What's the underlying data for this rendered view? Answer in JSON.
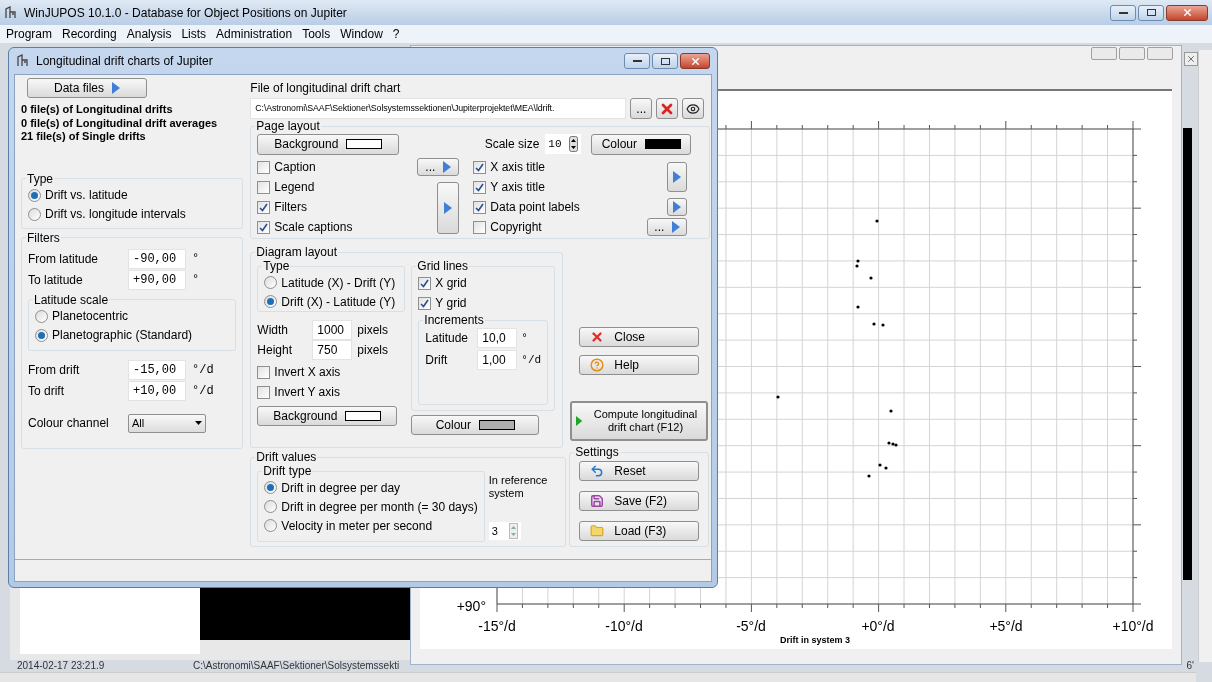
{
  "app_window": {
    "title": "WinJUPOS 10.1.0 - Database for Object Positions on Jupiter"
  },
  "menu": [
    "Program",
    "Recording",
    "Analysis",
    "Lists",
    "Administration",
    "Tools",
    "Window",
    "?"
  ],
  "dialog": {
    "title": "Longitudinal drift charts of Jupiter",
    "data_files_button": "Data files",
    "file_counts": [
      "0 file(s) of Longitudinal drifts",
      "0 file(s) of Longitudinal drift averages",
      "21 file(s) of Single drifts"
    ],
    "type_group": {
      "legend": "Type",
      "options": [
        {
          "label": "Drift vs. latitude",
          "selected": true
        },
        {
          "label": "Drift vs. longitude intervals",
          "selected": false
        }
      ]
    },
    "filters": {
      "legend": "Filters",
      "latitude_fields": [
        {
          "label": "From latitude",
          "value": "-90,00",
          "unit": "°"
        },
        {
          "label": "To latitude",
          "value": "+90,00",
          "unit": "°"
        }
      ],
      "latitude_scale": {
        "legend": "Latitude scale",
        "options": [
          {
            "label": "Planetocentric",
            "selected": false
          },
          {
            "label": "Planetographic (Standard)",
            "selected": true
          }
        ]
      },
      "drift_fields": [
        {
          "label": "From drift",
          "value": "-15,00",
          "unit": "°/d"
        },
        {
          "label": "To drift",
          "value": "+10,00",
          "unit": "°/d"
        }
      ],
      "colour_channel": {
        "label": "Colour channel",
        "value": "All"
      }
    },
    "file": {
      "label": "File of longitudinal drift chart",
      "value": "C:\\Astronomi\\SAAF\\Sektioner\\Solsystemssektionen\\Jupiterprojektet\\MEA\\ldrift.",
      "browse_button": "..."
    },
    "page_layout": {
      "legend": "Page layout",
      "background_button": "Background",
      "scale_size": {
        "label": "Scale size",
        "value": "10"
      },
      "colour_button": "Colour",
      "left_checks": [
        {
          "label": "Caption",
          "checked": false
        },
        {
          "label": "Legend",
          "checked": false
        },
        {
          "label": "Filters",
          "checked": true
        },
        {
          "label": "Scale captions",
          "checked": true
        }
      ],
      "right_checks": [
        {
          "label": "X axis title",
          "checked": true
        },
        {
          "label": "Y axis title",
          "checked": true
        },
        {
          "label": "Data point labels",
          "checked": true
        },
        {
          "label": "Copyright",
          "checked": false
        }
      ],
      "caption_more_button": "...",
      "copyright_more_button": "..."
    },
    "diagram_layout": {
      "legend": "Diagram layout",
      "type": {
        "legend": "Type",
        "options": [
          {
            "label": "Latitude (X) - Drift (Y)",
            "selected": false
          },
          {
            "label": "Drift (X) - Latitude (Y)",
            "selected": true
          }
        ]
      },
      "size_fields": [
        {
          "label": "Width",
          "value": "1000",
          "unit": "pixels"
        },
        {
          "label": "Height",
          "value": "750",
          "unit": "pixels"
        }
      ],
      "invert_checks": [
        {
          "label": "Invert X axis",
          "checked": false
        },
        {
          "label": "Invert Y axis",
          "checked": false
        }
      ],
      "background_button": "Background",
      "grid_lines": {
        "legend": "Grid lines",
        "checks": [
          {
            "label": "X grid",
            "checked": true
          },
          {
            "label": "Y grid",
            "checked": true
          }
        ],
        "increments": {
          "legend": "Increments",
          "fields": [
            {
              "label": "Latitude",
              "value": "10,0",
              "unit": "°"
            },
            {
              "label": "Drift",
              "value": "1,00",
              "unit": "°/d"
            }
          ]
        }
      },
      "colour_button": "Colour"
    },
    "drift_values": {
      "legend": "Drift values",
      "drift_type": {
        "legend": "Drift type",
        "options": [
          {
            "label": "Drift in degree per day",
            "selected": true
          },
          {
            "label": "Drift in degree per month (= 30 days)",
            "selected": false
          },
          {
            "label": "Velocity in meter per second",
            "selected": false
          }
        ]
      },
      "reference_label": "In reference system",
      "reference_value": "3"
    },
    "close_button": "Close",
    "help_button": "Help",
    "compute_button": "Compute longitudinal drift chart (F12)",
    "settings": {
      "legend": "Settings",
      "reset_button": "Reset",
      "save_button": "Save (F2)",
      "load_button": "Load (F3)"
    }
  },
  "chart_window": {
    "x_ticks": [
      "-15°/d",
      "-10°/d",
      "-5°/d",
      "+0°/d",
      "+5°/d",
      "+10°/d"
    ],
    "y_tick": "+90°",
    "x_title": "Drift in system 3"
  },
  "log_row": {
    "timestamp": "2014-02-17  23:21.9",
    "path": "C:\\Astronomi\\SAAF\\Sektioner\\Solsystemssekti",
    "fragment": "6'"
  }
}
